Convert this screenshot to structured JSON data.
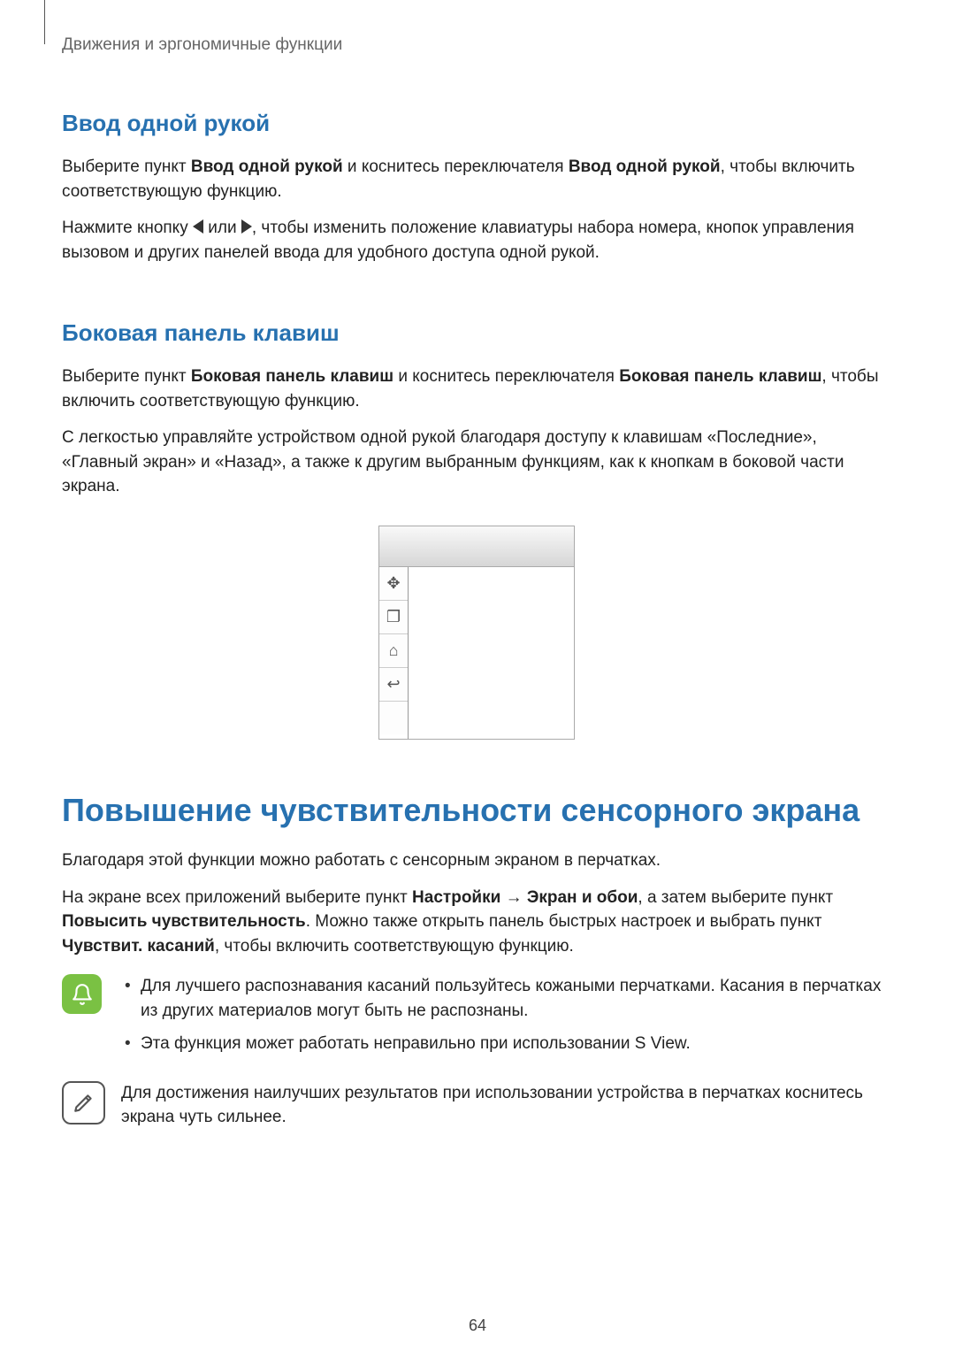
{
  "header": {
    "breadcrumb": "Движения и эргономичные функции"
  },
  "section1": {
    "title": "Ввод одной рукой",
    "p1_a": "Выберите пункт ",
    "p1_b1": "Ввод одной рукой",
    "p1_c": " и коснитесь переключателя ",
    "p1_b2": "Ввод одной рукой",
    "p1_d": ", чтобы включить соответствующую функцию.",
    "p2_a": "Нажмите кнопку ",
    "p2_b": " или ",
    "p2_c": ", чтобы изменить положение клавиатуры набора номера, кнопок управления вызовом и других панелей ввода для удобного доступа одной рукой."
  },
  "section2": {
    "title": "Боковая панель клавиш",
    "p1_a": "Выберите пункт ",
    "p1_b1": "Боковая панель клавиш",
    "p1_c": " и коснитесь переключателя ",
    "p1_b2": "Боковая панель клавиш",
    "p1_d": ", чтобы включить соответствующую функцию.",
    "p2": "С легкостью управляйте устройством одной рукой благодаря доступу к клавишам «Последние», «Главный экран» и «Назад», а также к другим выбранным функциям, как к кнопкам в боковой части экрана."
  },
  "phone_icons": {
    "move": "✥",
    "recent": "❐",
    "home": "⌂",
    "back": "↩"
  },
  "section3": {
    "title": "Повышение чувствительности сенсорного экрана",
    "p1": "Благодаря этой функции можно работать с сенсорным экраном в перчатках.",
    "p2_a": "На экране всех приложений выберите пункт ",
    "p2_b1": "Настройки",
    "p2_arrow": " → ",
    "p2_b2": "Экран и обои",
    "p2_c": ", а затем выберите пункт ",
    "p2_b3": "Повысить чувствительность",
    "p2_d": ". Можно также открыть панель быстрых настроек и выбрать пункт ",
    "p2_b4": "Чувствит. касаний",
    "p2_e": ", чтобы включить соответствующую функцию."
  },
  "note1": {
    "li1": "Для лучшего распознавания касаний пользуйтесь кожаными перчатками. Касания в перчатках из других материалов могут быть не распознаны.",
    "li2": "Эта функция может работать неправильно при использовании S View."
  },
  "note2": {
    "text": "Для достижения наилучших результатов при использовании устройства в перчатках коснитесь экрана чуть сильнее."
  },
  "page_number": "64"
}
